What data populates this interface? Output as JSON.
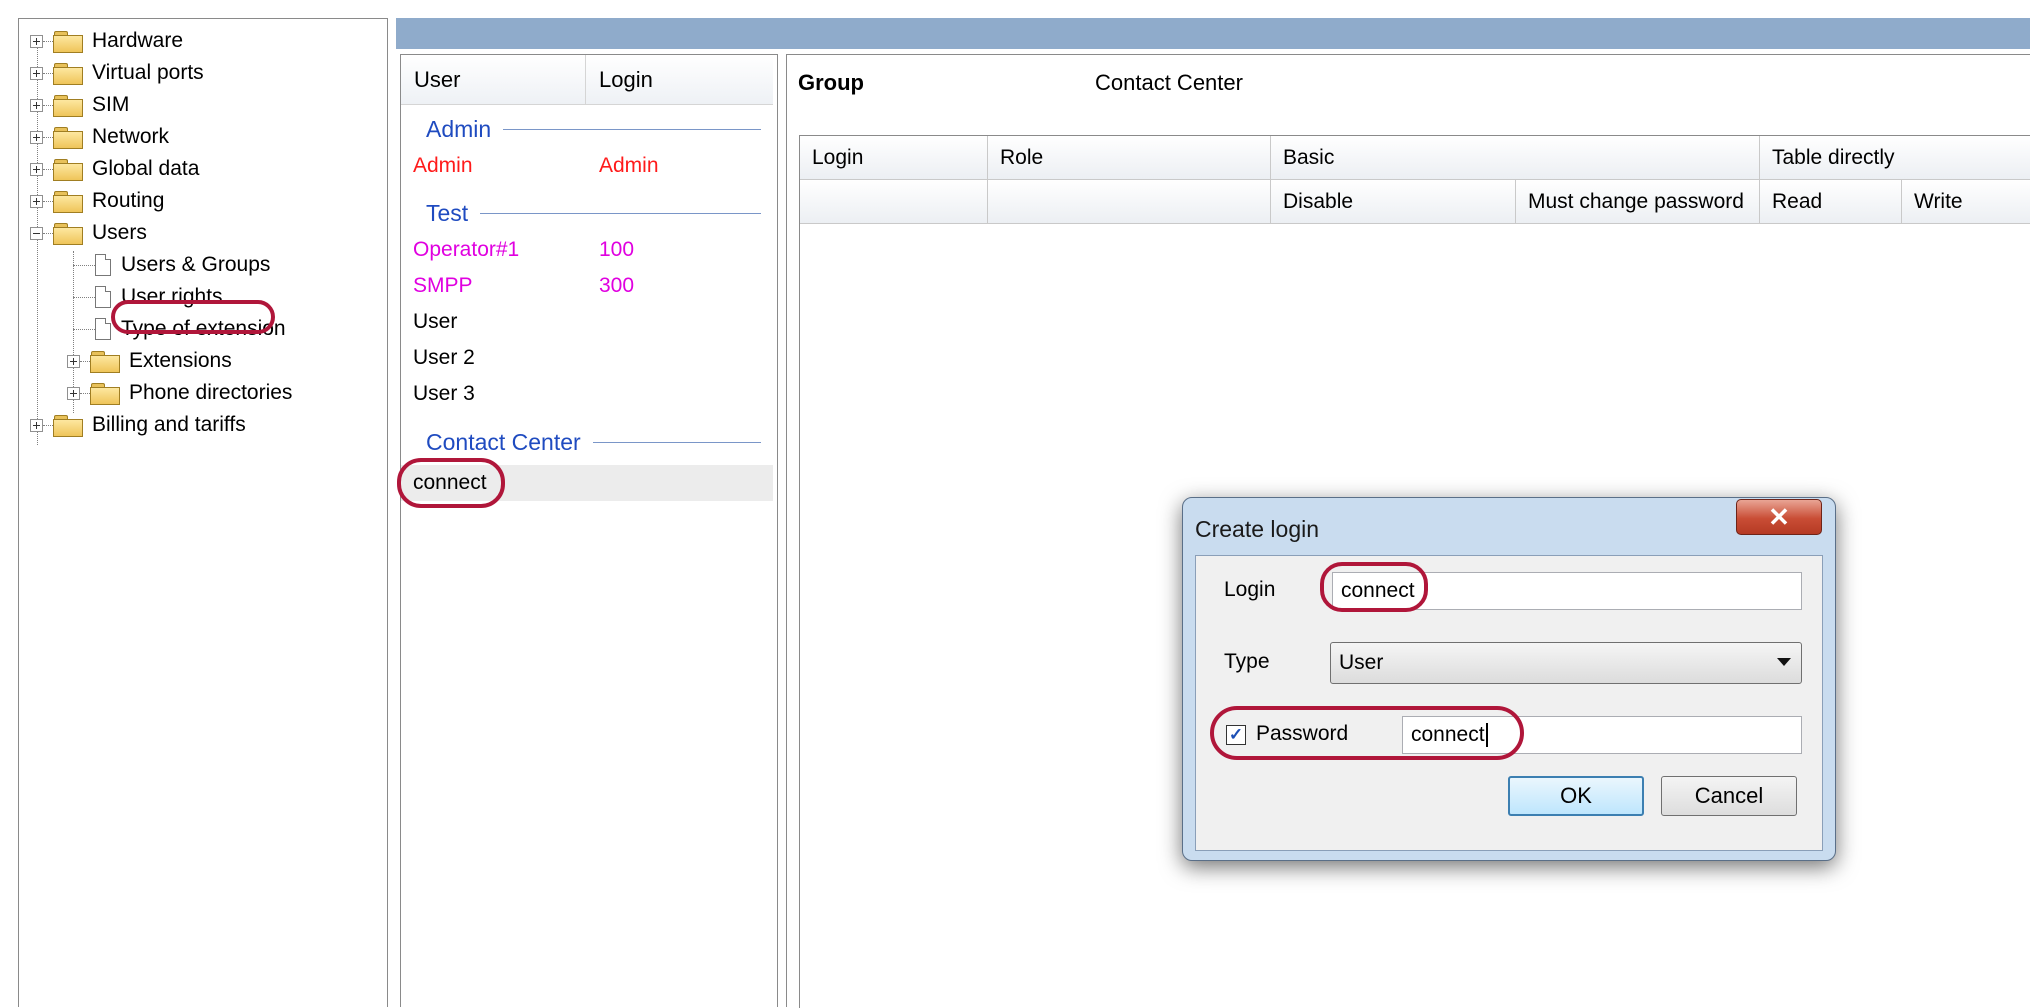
{
  "tree": {
    "items": [
      {
        "label": "Hardware"
      },
      {
        "label": "Virtual ports"
      },
      {
        "label": "SIM"
      },
      {
        "label": "Network"
      },
      {
        "label": "Global data"
      },
      {
        "label": "Routing"
      },
      {
        "label": "Users"
      },
      {
        "label": "Users & Groups"
      },
      {
        "label": "User rights"
      },
      {
        "label": "Type of extension"
      },
      {
        "label": "Extensions"
      },
      {
        "label": "Phone directories"
      },
      {
        "label": "Billing and tariffs"
      }
    ]
  },
  "user_list": {
    "headers": {
      "user": "User",
      "login": "Login"
    },
    "groups": [
      {
        "name": "Admin",
        "rows": [
          {
            "user": "Admin",
            "login": "Admin",
            "color": "#ff1a1a"
          }
        ]
      },
      {
        "name": "Test",
        "rows": [
          {
            "user": "Operator#1",
            "login": "100",
            "color": "#e000e0"
          },
          {
            "user": "SMPP",
            "login": "300",
            "color": "#e000e0"
          },
          {
            "user": "User",
            "login": "",
            "color": "#000000"
          },
          {
            "user": "User 2",
            "login": "",
            "color": "#000000"
          },
          {
            "user": "User 3",
            "login": "",
            "color": "#000000"
          }
        ]
      },
      {
        "name": "Contact Center",
        "rows": [
          {
            "user": "connect",
            "login": "",
            "color": "#000000"
          }
        ]
      }
    ]
  },
  "right_panel": {
    "group_label": "Group",
    "group_value": "Contact Center",
    "grid_headers": {
      "login": "Login",
      "role": "Role",
      "basic": "Basic",
      "table_directly": "Table directly",
      "disable": "Disable",
      "must_change_password": "Must change password",
      "read": "Read",
      "write": "Write"
    }
  },
  "dialog": {
    "title": "Create login",
    "close_glyph": "✕",
    "login_label": "Login",
    "login_value": "connect",
    "type_label": "Type",
    "type_value": "User",
    "password_label": "Password",
    "password_checked": true,
    "password_value": "connect",
    "ok_label": "OK",
    "cancel_label": "Cancel"
  },
  "colors": {
    "highlight": "#b0163a",
    "title_band": "#8fabcb",
    "group_text": "#1f4bc0"
  }
}
